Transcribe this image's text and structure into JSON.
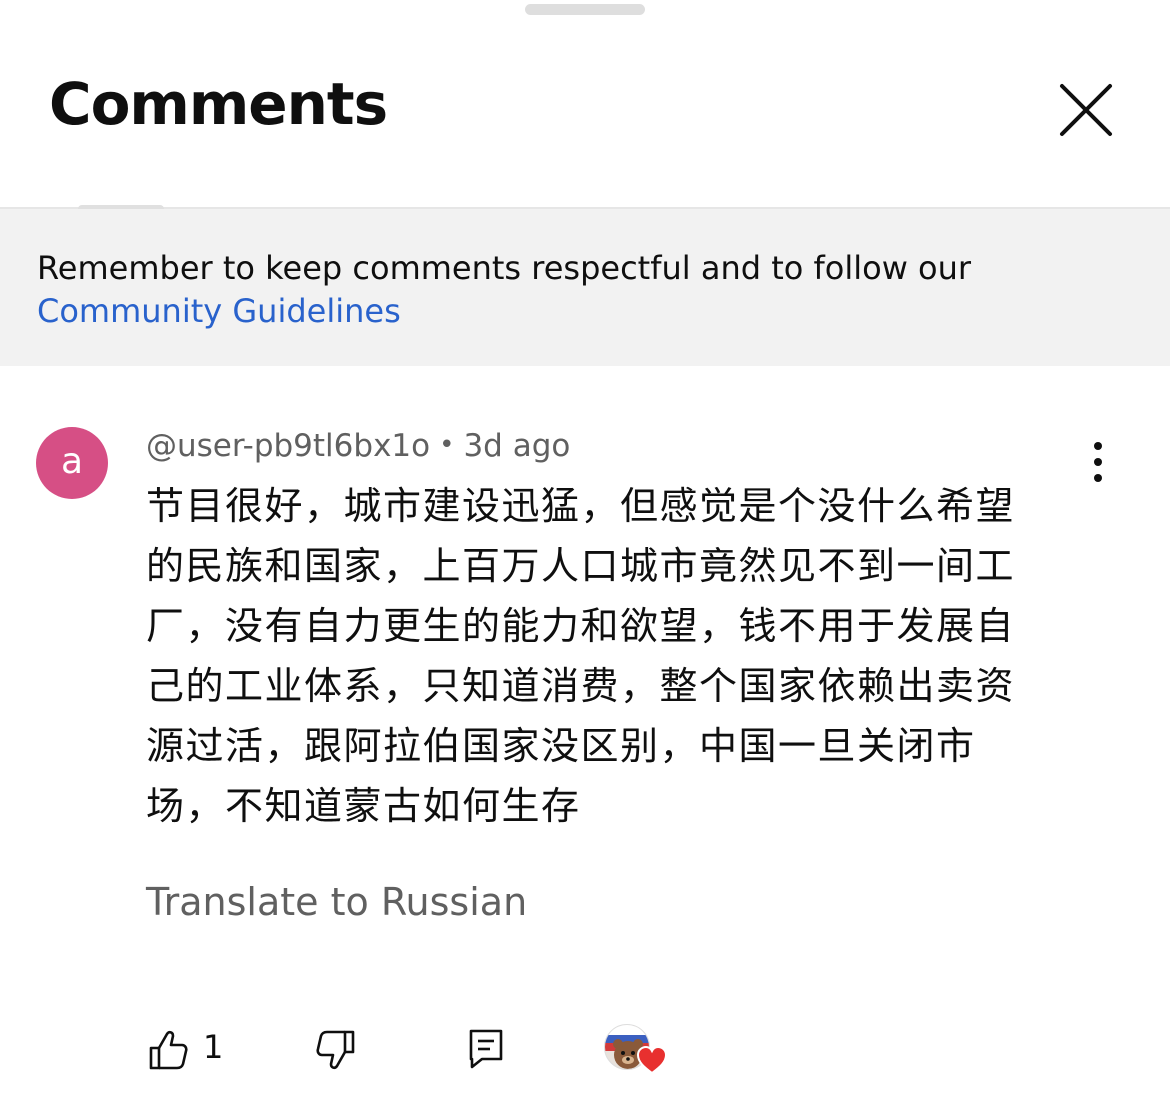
{
  "header": {
    "title": "Comments"
  },
  "notice": {
    "text": "Remember to keep comments respectful and to follow our",
    "link": "Community Guidelines"
  },
  "comment": {
    "avatar_letter": "a",
    "username": "@user-pb9tl6bx1o",
    "separator": "•",
    "time": "3d ago",
    "text": "节目很好，城市建设迅猛，但感觉是个没什么希望的民族和国家，上百万人口城市竟然见不到一间工厂，没有自力更生的能力和欲望，钱不用于发展自己的工业体系，只知道消费，整个国家依赖出卖资源过活，跟阿拉伯国家没区别，中国一旦关闭市场，不知道蒙古如何生存",
    "translate_label": "Translate to Russian",
    "like_count": "1"
  },
  "colors": {
    "avatar_bg": "#d64f85",
    "link": "#2962cc",
    "notice_bg": "#f2f2f2",
    "secondary_text": "#606060",
    "heart": "#e8302f"
  },
  "icons": {
    "close": "close-icon",
    "more": "more-vertical-icon",
    "like": "thumbs-up-icon",
    "dislike": "thumbs-down-icon",
    "reply": "reply-comment-icon",
    "creator_heart": "creator-heart-icon"
  }
}
